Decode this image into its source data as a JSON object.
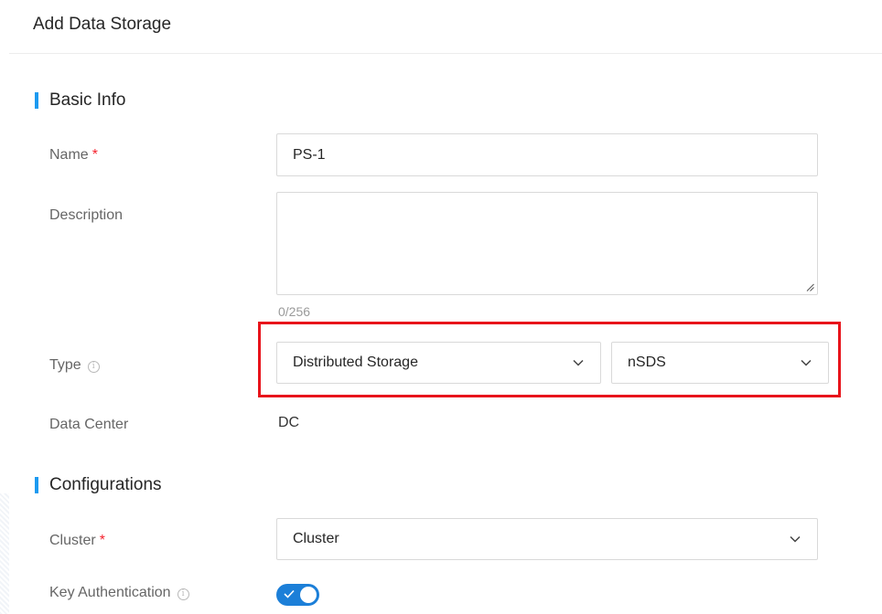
{
  "dialog": {
    "title": "Add Data Storage"
  },
  "basic_info": {
    "section_title": "Basic Info",
    "name_label": "Name",
    "required_mark": "*",
    "name_value": "PS-1",
    "description_label": "Description",
    "description_value": "",
    "description_counter": "0/256",
    "type_label": "Type",
    "type_info_icon": "info-icon",
    "type_primary_value": "Distributed Storage",
    "type_secondary_value": "nSDS",
    "datacenter_label": "Data Center",
    "datacenter_value": "DC"
  },
  "configurations": {
    "section_title": "Configurations",
    "cluster_label": "Cluster",
    "required_mark": "*",
    "cluster_value": "Cluster",
    "key_auth_label": "Key Authentication",
    "key_auth_info_icon": "info-icon",
    "key_auth_enabled": true
  },
  "colors": {
    "accent": "#1c9af0",
    "toggle_on": "#1c7fd8",
    "required": "#f5222d",
    "highlight": "#e8141b"
  }
}
